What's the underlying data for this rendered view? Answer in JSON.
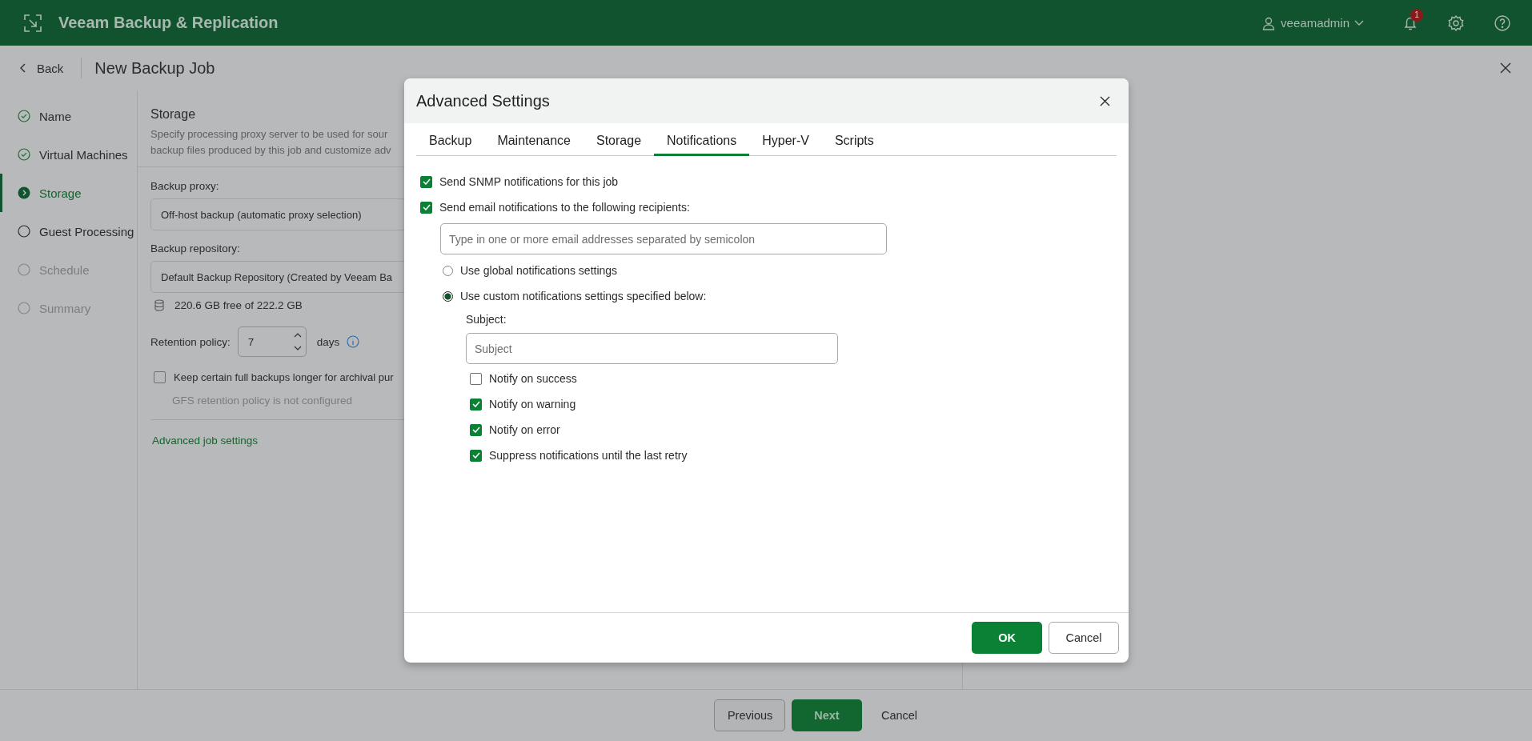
{
  "app": {
    "title": "Veeam Backup & Replication",
    "user": "veeamadmin",
    "notification_count": "1"
  },
  "wizard": {
    "back": "Back",
    "title": "New Backup Job"
  },
  "steps": [
    {
      "label": "Name",
      "kind": "done",
      "selected": false
    },
    {
      "label": "Virtual Machines",
      "kind": "done",
      "selected": false
    },
    {
      "label": "Storage",
      "kind": "current",
      "selected": true
    },
    {
      "label": "Guest Processing",
      "kind": "pending",
      "selected": false
    },
    {
      "label": "Schedule",
      "kind": "disabled",
      "selected": false
    },
    {
      "label": "Summary",
      "kind": "disabled",
      "selected": false
    }
  ],
  "storage": {
    "heading": "Storage",
    "description_lines": [
      "Specify processing proxy server to be used for sour",
      "backup files produced by this job and customize adv"
    ],
    "proxy_label": "Backup proxy:",
    "proxy_value": "Off-host backup (automatic proxy selection)",
    "repository_label": "Backup repository:",
    "repository_value": "Default Backup Repository (Created by Veeam Ba",
    "free_space": "220.6 GB free of 222.2 GB",
    "retention_label": "Retention policy:",
    "retention_value": "7",
    "retention_unit": "days",
    "gfs": {
      "label": "Keep certain full backups longer for archival pur",
      "checked": false
    },
    "gfs_note": "GFS retention policy is not configured",
    "advanced_link": "Advanced job settings"
  },
  "footer_buttons": [
    "Previous",
    "Next",
    "Cancel"
  ],
  "dialog": {
    "title": "Advanced Settings",
    "tabs": [
      {
        "label": "Backup",
        "selected": false
      },
      {
        "label": "Maintenance",
        "selected": false
      },
      {
        "label": "Storage",
        "selected": false
      },
      {
        "label": "Notifications",
        "selected": true
      },
      {
        "label": "Hyper-V",
        "selected": false
      },
      {
        "label": "Scripts",
        "selected": false
      }
    ],
    "snmp": {
      "label": "Send SNMP notifications for this job",
      "checked": true
    },
    "email": {
      "label": "Send email notifications to the following recipients:",
      "checked": true
    },
    "recipients_field": {
      "placeholder": "Type in one or more email addresses separated by semicolon"
    },
    "modes": [
      {
        "label": "Use global notifications settings",
        "selected": false
      },
      {
        "label": "Use custom notifications settings specified below:",
        "selected": true
      }
    ],
    "subject_label": "Subject:",
    "subject_field": {
      "placeholder": "Subject"
    },
    "notify": [
      {
        "label": "Notify on success",
        "checked": false
      },
      {
        "label": "Notify on warning",
        "checked": true
      },
      {
        "label": "Notify on error",
        "checked": true
      },
      {
        "label": "Suppress notifications until the last retry",
        "checked": true
      }
    ],
    "buttons": [
      "OK",
      "Cancel"
    ]
  }
}
